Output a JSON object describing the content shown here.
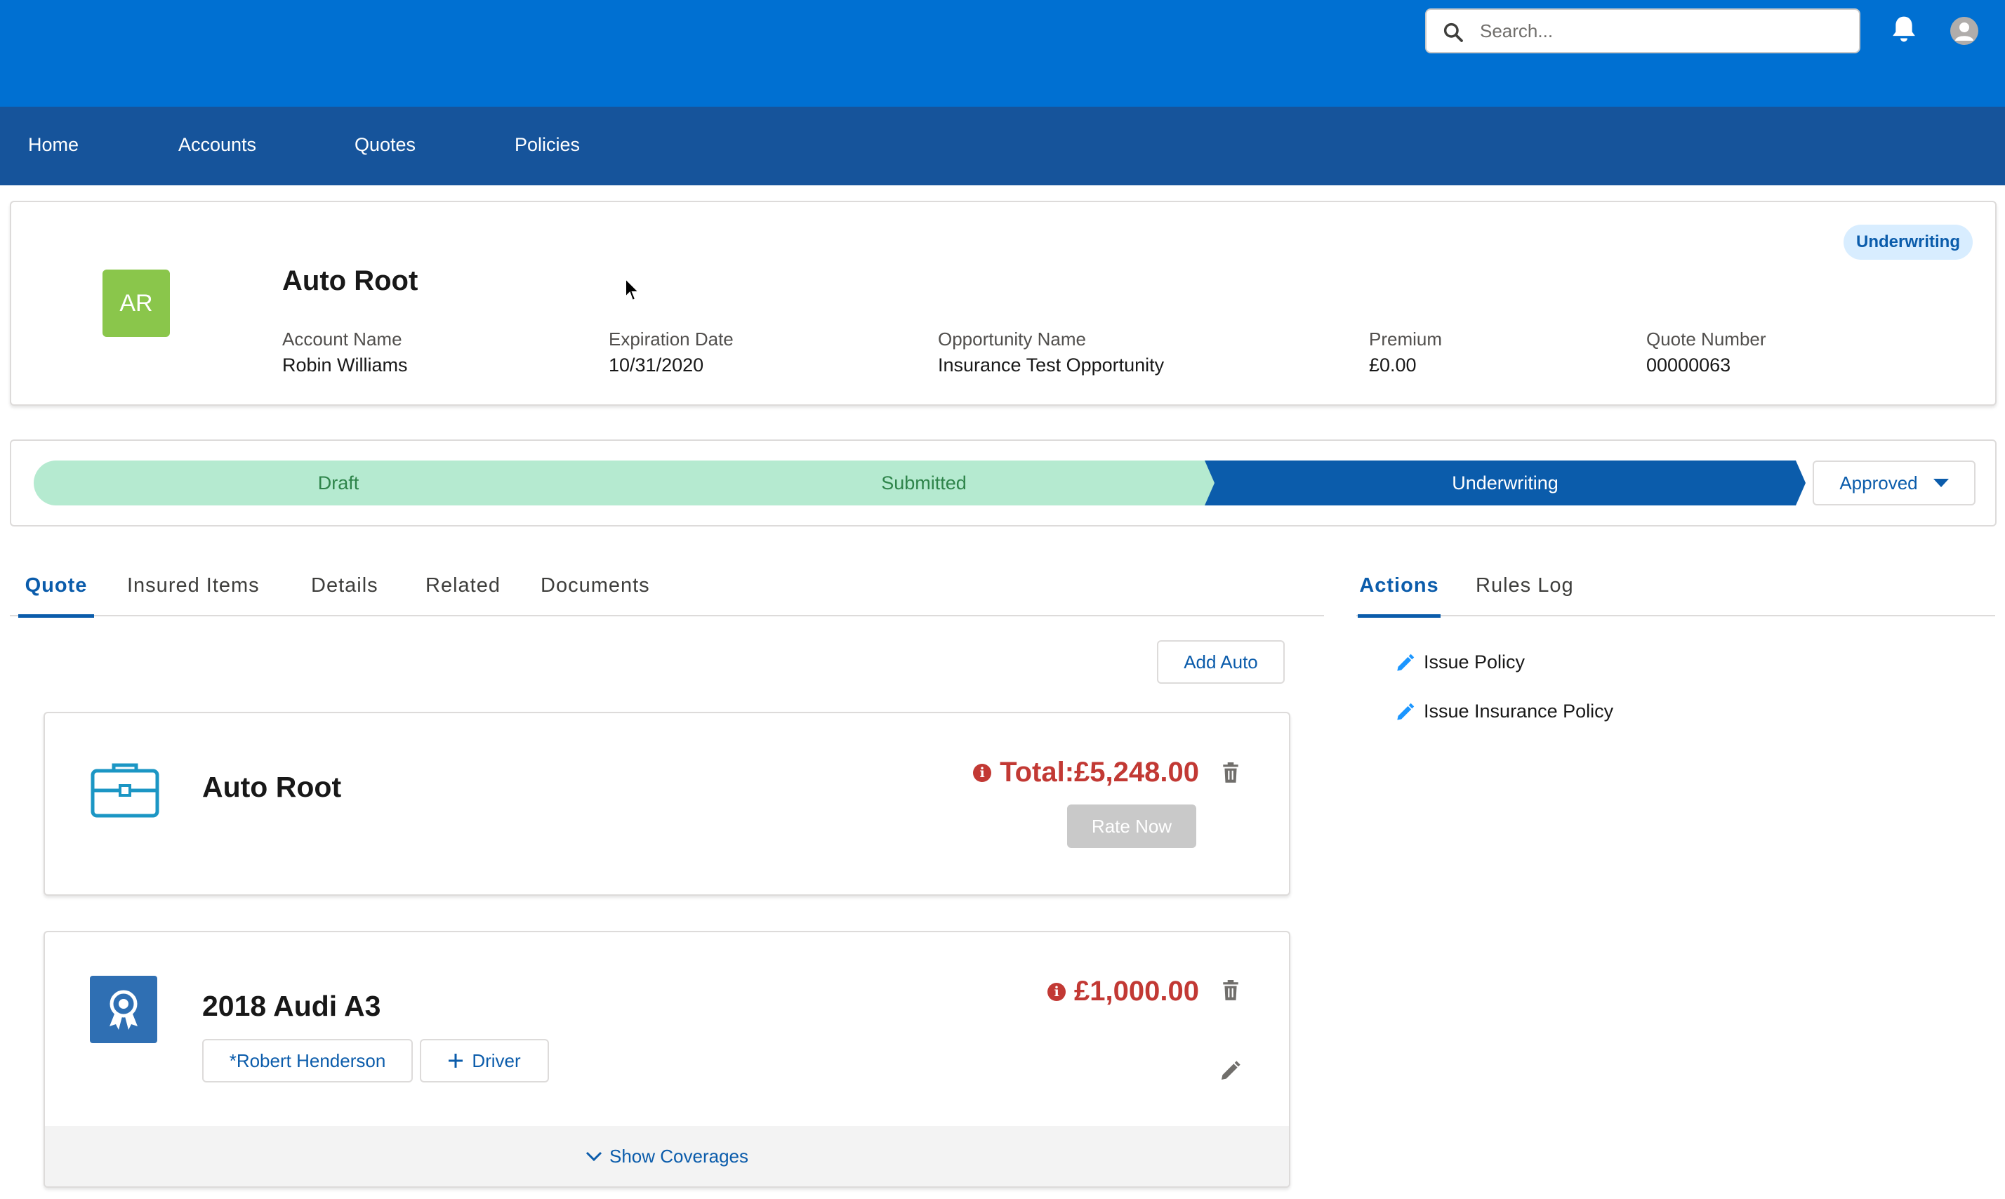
{
  "search": {
    "placeholder": "Search..."
  },
  "nav": {
    "items": [
      "Home",
      "Accounts",
      "Quotes",
      "Policies"
    ]
  },
  "record": {
    "avatar_initials": "AR",
    "avatar_color": "#8ac64b",
    "title": "Auto Root",
    "status": "Underwriting",
    "fields": [
      {
        "label": "Account Name",
        "value": "Robin Williams"
      },
      {
        "label": "Expiration Date",
        "value": "10/31/2020"
      },
      {
        "label": "Opportunity Name",
        "value": "Insurance Test Opportunity"
      },
      {
        "label": "Premium",
        "value": "£0.00"
      },
      {
        "label": "Quote Number",
        "value": "00000063"
      }
    ]
  },
  "path": {
    "steps": [
      {
        "label": "Draft",
        "state": "complete"
      },
      {
        "label": "Submitted",
        "state": "complete"
      },
      {
        "label": "Underwriting",
        "state": "current"
      }
    ],
    "next_status": "Approved"
  },
  "tabs": {
    "main": [
      "Quote",
      "Insured Items",
      "Details",
      "Related",
      "Documents"
    ],
    "main_active": "Quote",
    "side": [
      "Actions",
      "Rules Log"
    ],
    "side_active": "Actions"
  },
  "quote": {
    "add_button": "Add Auto",
    "root": {
      "title": "Auto Root",
      "total": "Total:£5,248.00",
      "rate_button": "Rate Now",
      "icon": "briefcase-icon"
    },
    "item": {
      "title": "2018 Audi A3",
      "amount": "£1,000.00",
      "icon": "award-icon",
      "driver": "*Robert Henderson",
      "add_driver": "Driver",
      "show_coverages": "Show Coverages"
    }
  },
  "actions": [
    "Issue Policy",
    "Issue Insurance Policy"
  ],
  "colors": {
    "header": "#0070d2",
    "nav": "#16549b",
    "brand": "#0b5cab",
    "path_complete": "#b5ead0",
    "error": "#c23934"
  }
}
